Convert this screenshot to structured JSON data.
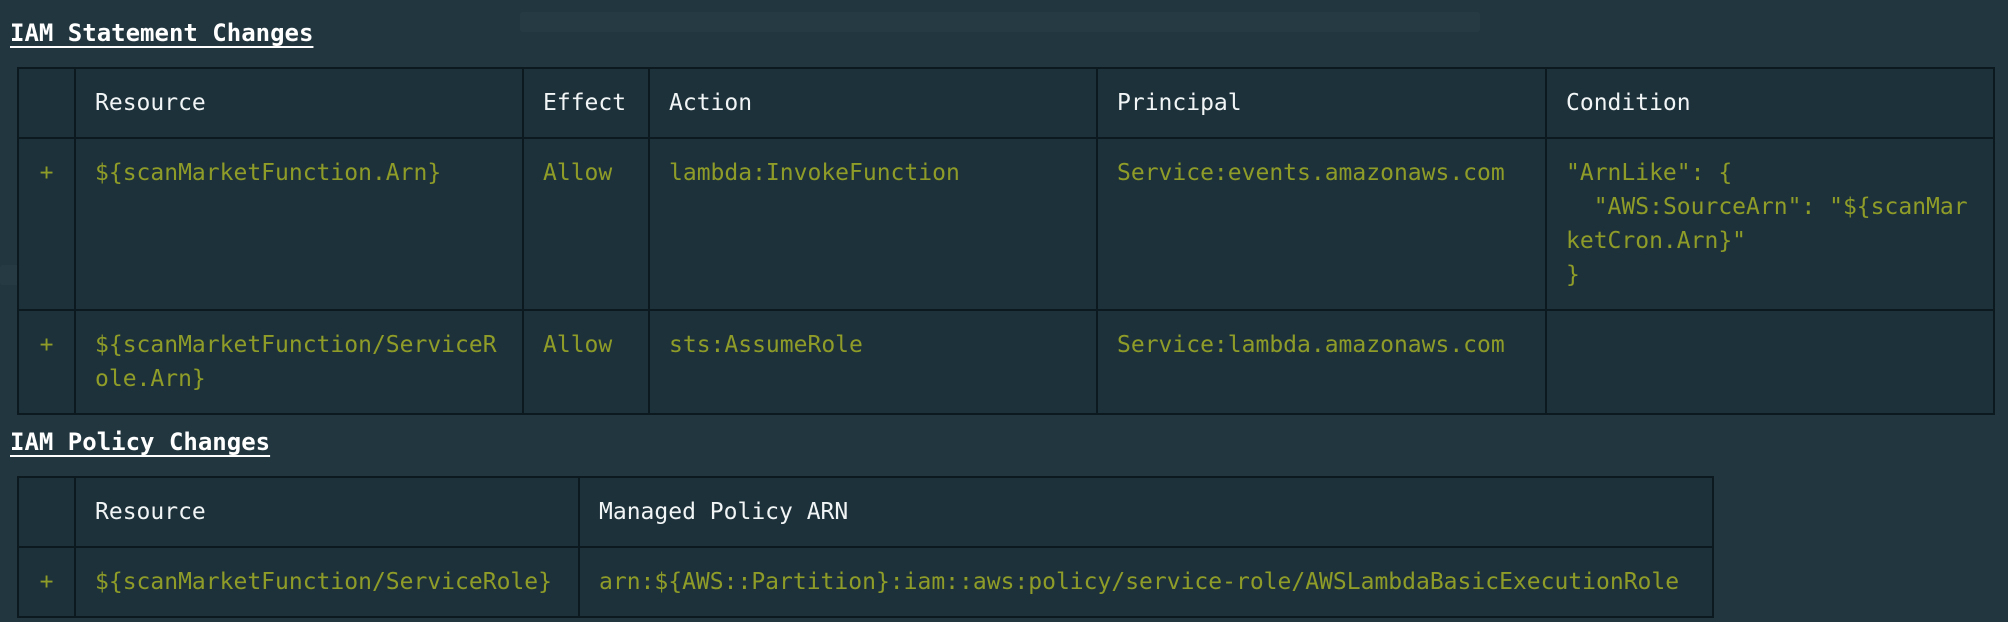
{
  "colors": {
    "background": "#21363f",
    "table_background": "#1d313a",
    "border": "#0c1a20",
    "header_text": "#f1f5f6",
    "added_text": "#8f9d28"
  },
  "statement_changes": {
    "title": "IAM Statement Changes",
    "columns": [
      "",
      "Resource",
      "Effect",
      "Action",
      "Principal",
      "Condition"
    ],
    "rows": [
      {
        "sign": "+",
        "resource": "${scanMarketFunction.Arn}",
        "effect": "Allow",
        "action": "lambda:InvokeFunction",
        "principal": "Service:events.amazonaws.com",
        "condition": "\"ArnLike\": {\n  \"AWS:SourceArn\": \"${scanMarketCron.Arn}\"\n}"
      },
      {
        "sign": "+",
        "resource": "${scanMarketFunction/ServiceRole.Arn}",
        "effect": "Allow",
        "action": "sts:AssumeRole",
        "principal": "Service:lambda.amazonaws.com",
        "condition": ""
      }
    ]
  },
  "policy_changes": {
    "title": "IAM Policy Changes",
    "columns": [
      "",
      "Resource",
      "Managed Policy ARN"
    ],
    "rows": [
      {
        "sign": "+",
        "resource": "${scanMarketFunction/ServiceRole}",
        "managed_policy_arn": "arn:${AWS::Partition}:iam::aws:policy/service-role/AWSLambdaBasicExecutionRole"
      }
    ]
  }
}
